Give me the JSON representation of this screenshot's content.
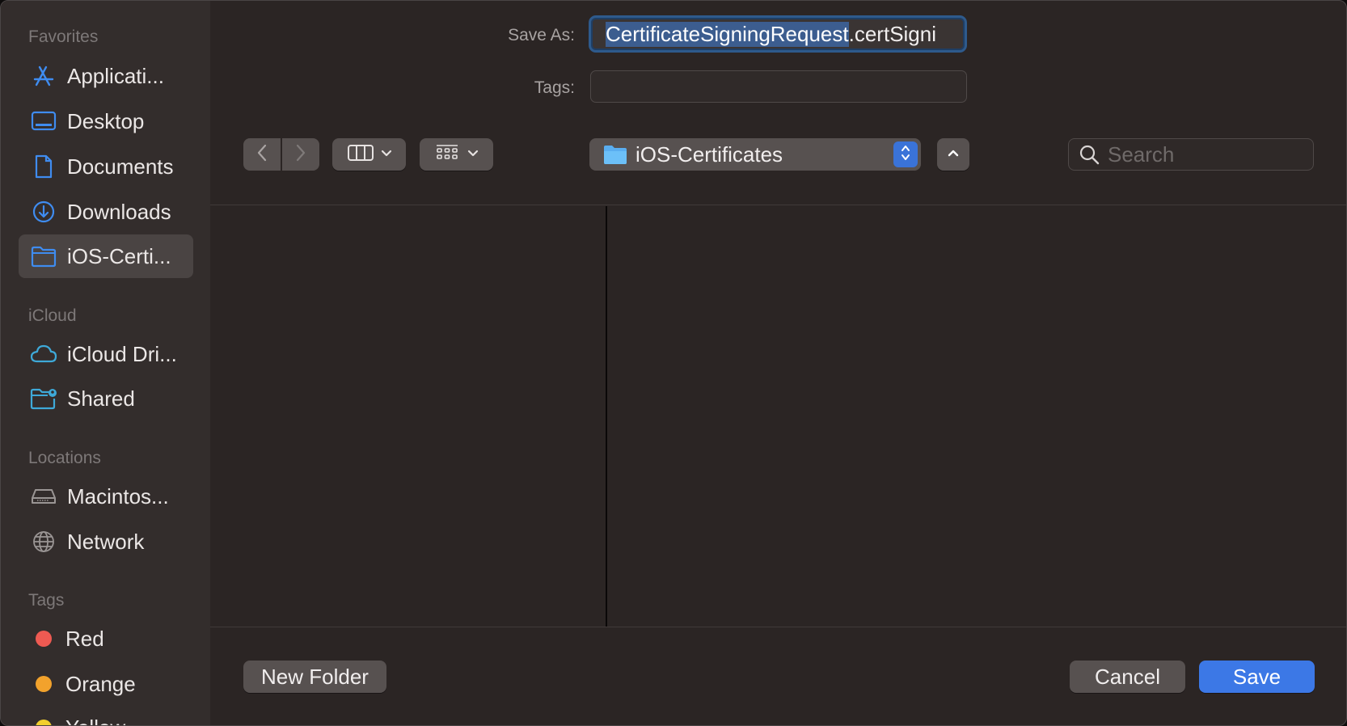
{
  "sidebar": {
    "sections": {
      "favorites": "Favorites",
      "icloud": "iCloud",
      "locations": "Locations",
      "tags": "Tags"
    },
    "favorites": [
      {
        "label": "Applicati...",
        "icon": "applications-icon"
      },
      {
        "label": "Desktop",
        "icon": "desktop-icon"
      },
      {
        "label": "Documents",
        "icon": "document-icon"
      },
      {
        "label": "Downloads",
        "icon": "download-icon"
      },
      {
        "label": "iOS-Certi...",
        "icon": "folder-icon",
        "selected": true
      }
    ],
    "icloud": [
      {
        "label": "iCloud Dri...",
        "icon": "cloud-icon"
      },
      {
        "label": "Shared",
        "icon": "shared-folder-icon"
      }
    ],
    "locations": [
      {
        "label": "Macintos...",
        "icon": "hard-drive-icon"
      },
      {
        "label": "Network",
        "icon": "globe-icon"
      }
    ],
    "tags": [
      {
        "label": "Red",
        "color": "#ee5a52"
      },
      {
        "label": "Orange",
        "color": "#f2a22c"
      },
      {
        "label": "Yellow",
        "color": "#f2cf2c"
      }
    ]
  },
  "form": {
    "save_as_label": "Save As:",
    "filename_selected": "CertificateSigningRequest",
    "filename_rest": ".certSigni",
    "tags_label": "Tags:",
    "tags_value": ""
  },
  "toolbar": {
    "location": "iOS-Certificates",
    "search_placeholder": "Search"
  },
  "buttons": {
    "new_folder": "New Folder",
    "cancel": "Cancel",
    "save": "Save"
  },
  "colors": {
    "accent": "#3c78e6",
    "sidebar_icon": "#3f8cf0"
  }
}
